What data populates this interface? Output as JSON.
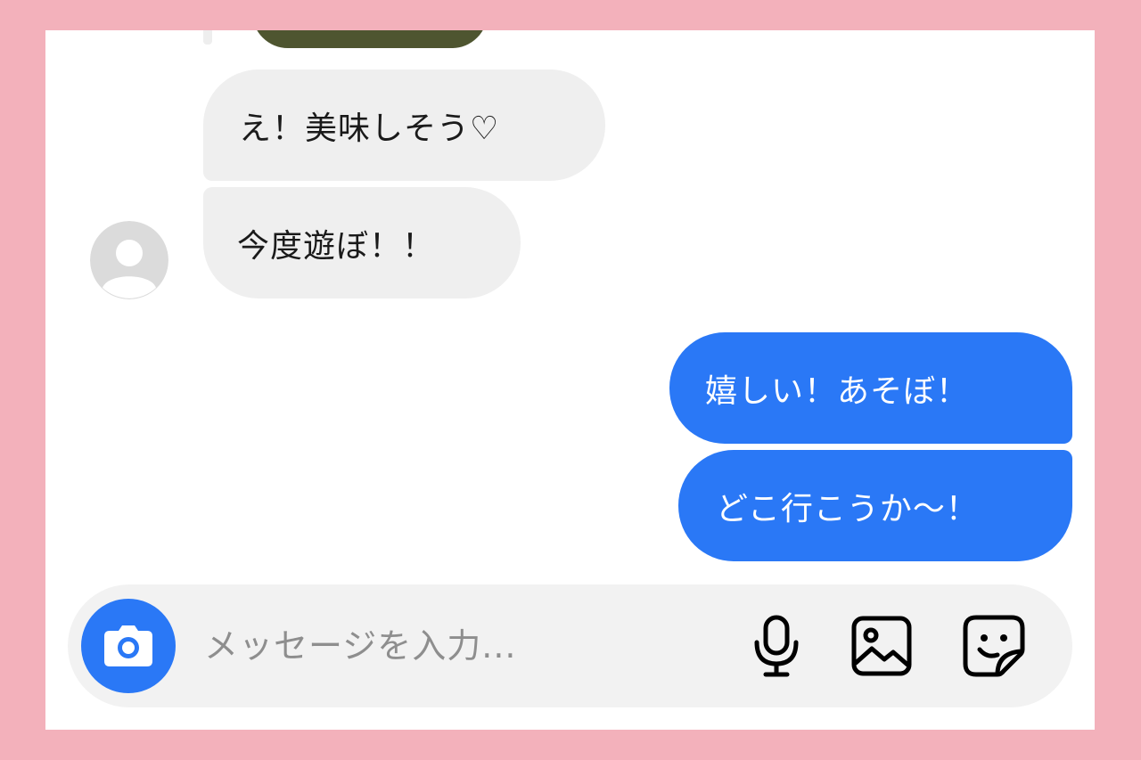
{
  "messages": {
    "received": [
      "え！美味しそう♡",
      "今度遊ぼ！！"
    ],
    "sent": [
      "嬉しい！あそぼ！",
      "どこ行こうか～！"
    ]
  },
  "composer": {
    "placeholder": "メッセージを入力..."
  },
  "icons": {
    "camera": "camera-icon",
    "microphone": "microphone-icon",
    "gallery": "image-icon",
    "sticker": "sticker-icon",
    "avatar": "default-avatar-icon"
  },
  "colors": {
    "outgoing_bubble": "#2a78f6",
    "incoming_bubble": "#efefef",
    "frame": "#f3b1bb"
  }
}
